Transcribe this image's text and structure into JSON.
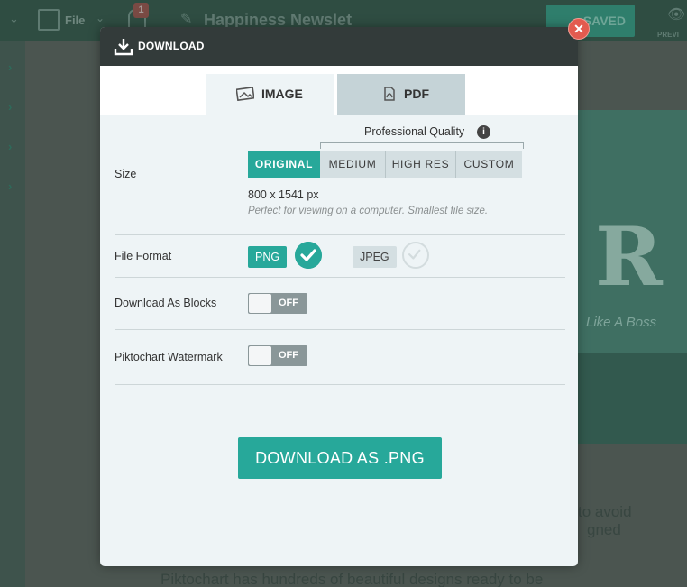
{
  "app": {
    "file_menu": "File",
    "notification_count": "1",
    "document_title": "Happiness Newslet",
    "saved_label": "SAVED",
    "preview_label": "PREVI",
    "canvas_tag": "Like A Boss",
    "canvas_text_1": "to avoid",
    "canvas_text_2": "gned",
    "canvas_text_3": "Piktochart has hundreds of beautiful designs ready to be"
  },
  "modal": {
    "title": "DOWNLOAD",
    "close_icon": "close-icon",
    "tabs": [
      {
        "label": "IMAGE",
        "icon": "image-icon",
        "active": true
      },
      {
        "label": "PDF",
        "icon": "pdf-icon",
        "active": false
      }
    ],
    "size": {
      "label": "Size",
      "professional_quality": "Professional Quality",
      "options": [
        "ORIGINAL",
        "MEDIUM",
        "HIGH RES",
        "CUSTOM"
      ],
      "selected": "ORIGINAL",
      "dimensions": "800 x 1541 px",
      "note": "Perfect for viewing on a computer. Smallest file size."
    },
    "file_format": {
      "label": "File Format",
      "options": [
        "PNG",
        "JPEG"
      ],
      "selected": "PNG"
    },
    "download_as_blocks": {
      "label": "Download As Blocks",
      "state": "OFF"
    },
    "watermark": {
      "label": "Piktochart Watermark",
      "state": "OFF"
    },
    "download_button": "DOWNLOAD AS .PNG"
  },
  "colors": {
    "accent": "#27a89a",
    "header": "#333b3a",
    "close": "#e35b4f"
  }
}
